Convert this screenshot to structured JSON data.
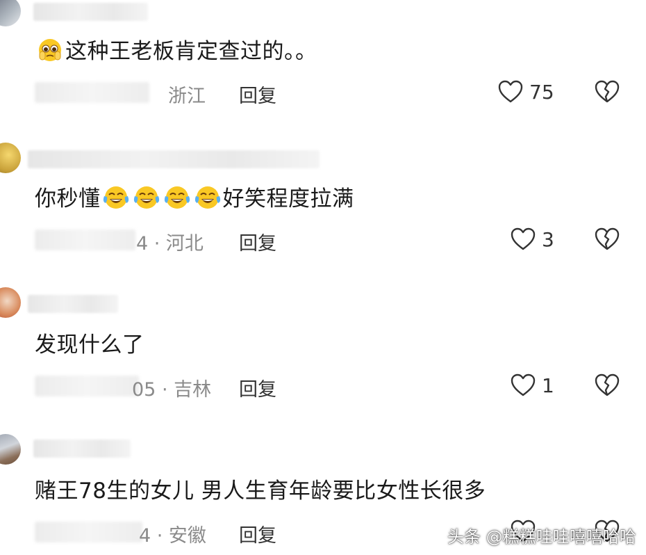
{
  "comments": [
    {
      "text": "这种王老板肯定查过的。。",
      "region": "浙江",
      "reply_label": "回复",
      "likes": "75"
    },
    {
      "text_before": "你秒懂",
      "text_after": "好笑程度拉满",
      "meta": "4 · 河北",
      "reply_label": "回复",
      "likes": "3"
    },
    {
      "text": "发现什么了",
      "meta": "05 · 吉林",
      "reply_label": "回复",
      "likes": "1"
    },
    {
      "text": "赌王78生的女儿 男人生育年龄要比女性长很多",
      "meta": "4 · 安徽",
      "reply_label": "回复"
    }
  ],
  "watermark": "头条 @糕糕哇哇嘻嘻哈哈",
  "colors": {
    "text": "#1a1a1a",
    "meta": "#8a8a8a",
    "icon": "#333333",
    "emoji_face": "#f9c824"
  }
}
